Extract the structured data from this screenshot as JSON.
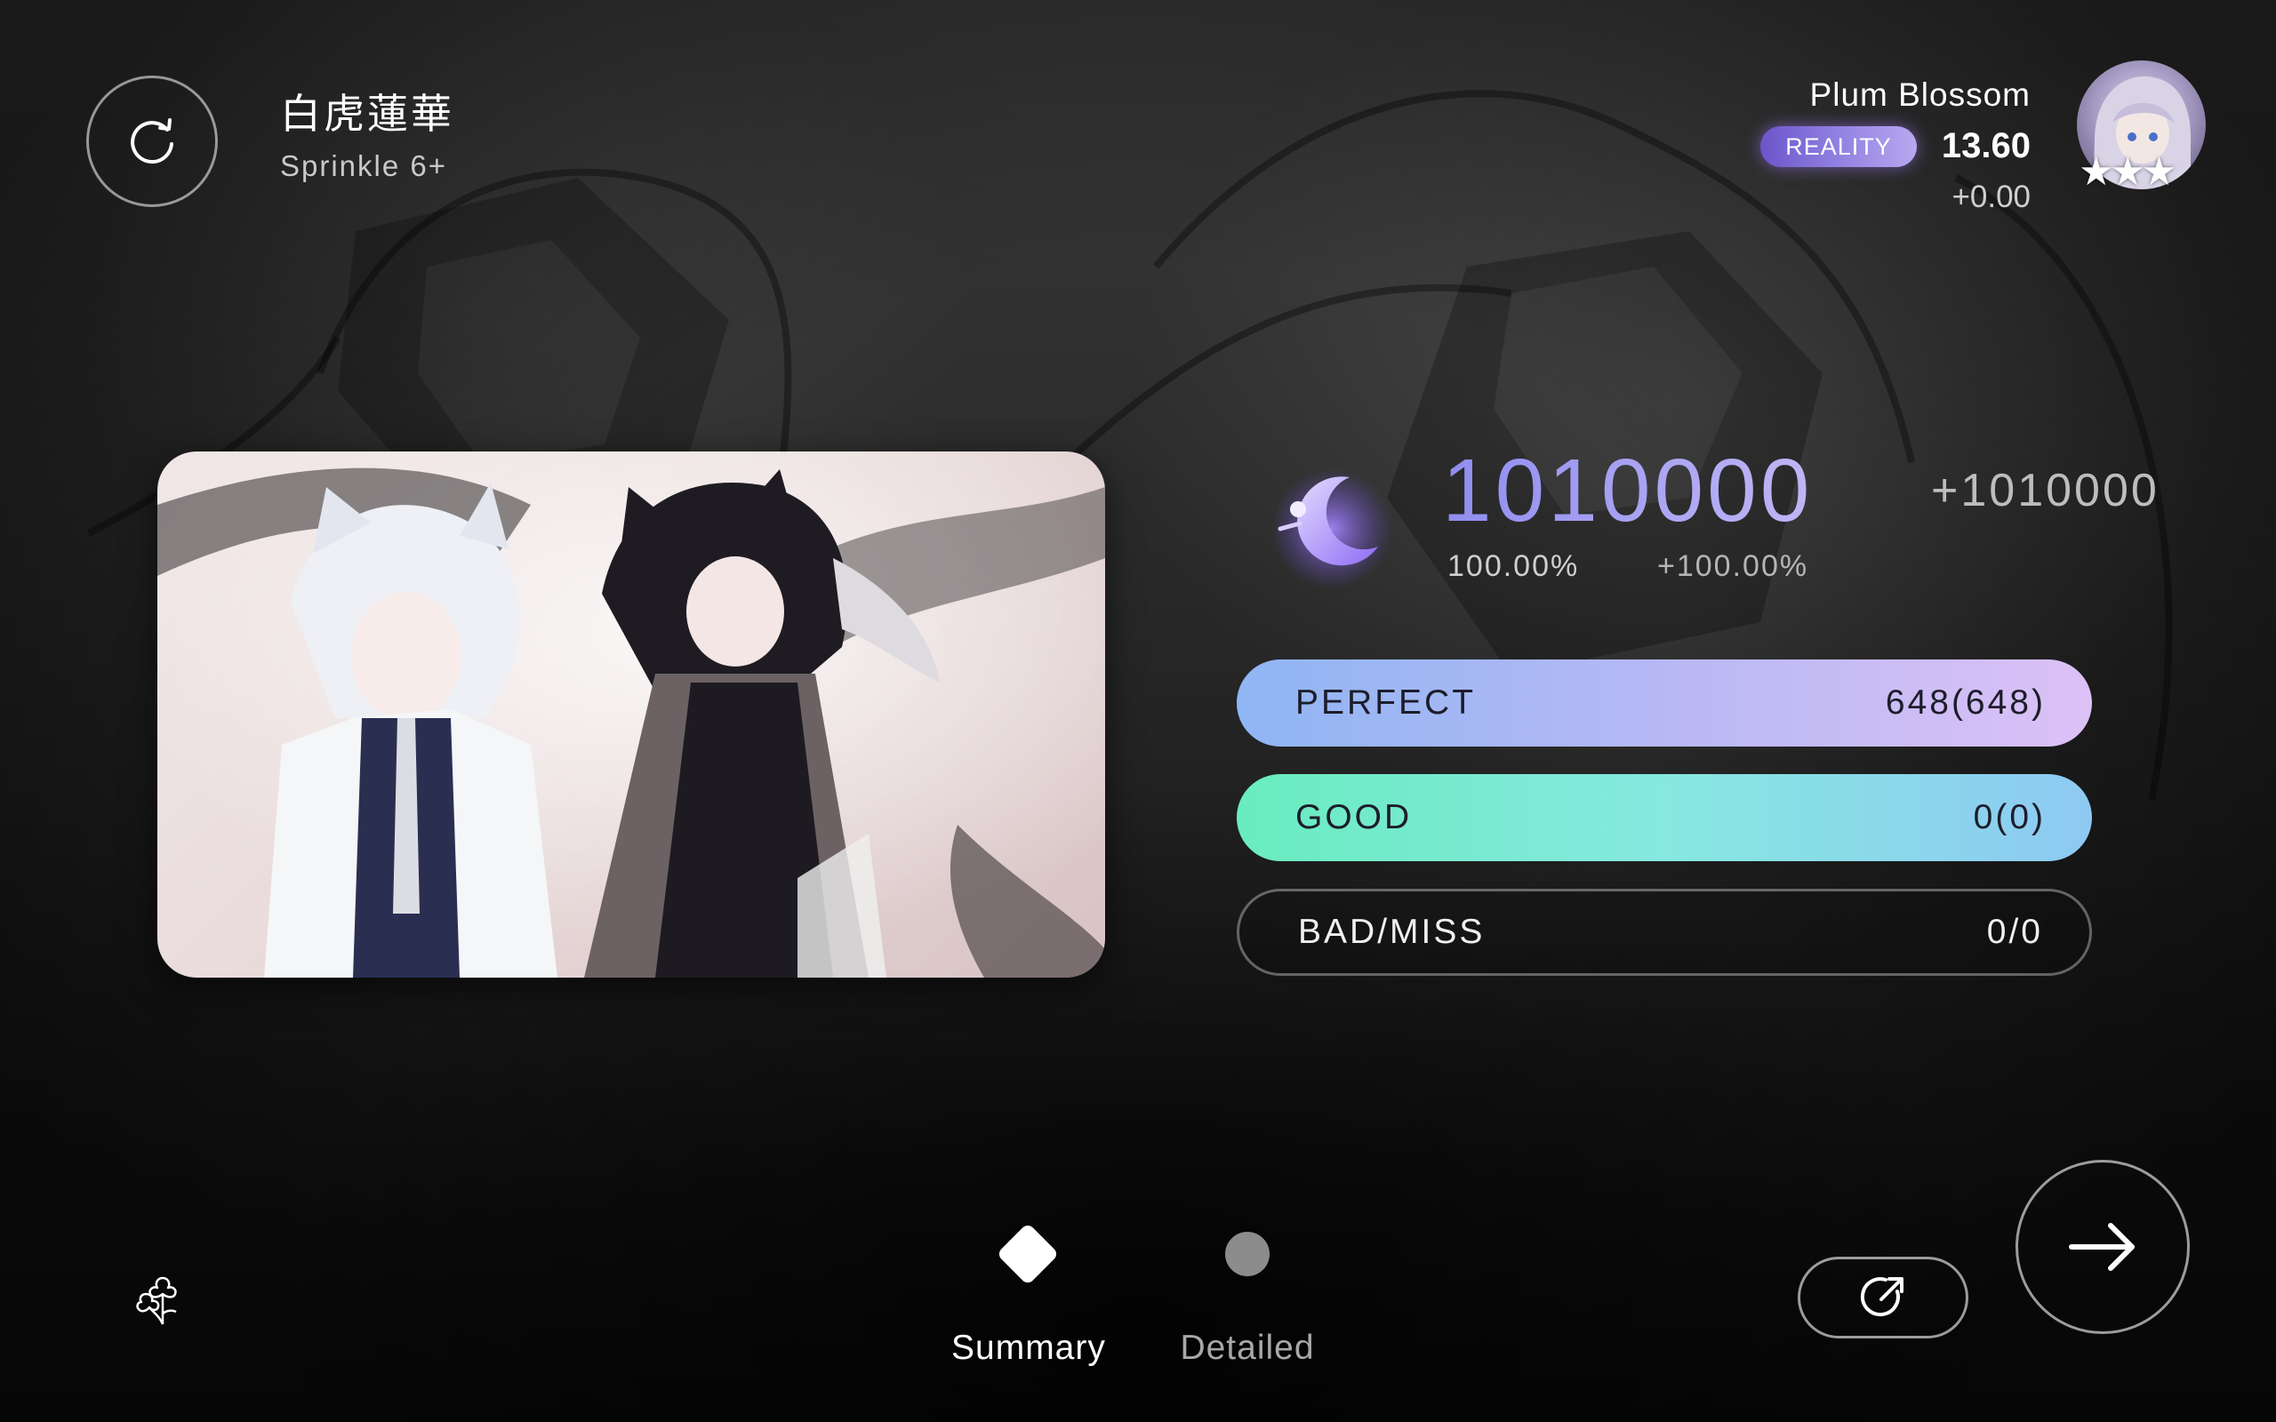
{
  "song": {
    "title": "白虎蓮華",
    "difficulty": "Sprinkle 6+"
  },
  "player": {
    "name": "Plum Blossom",
    "badge": "REALITY",
    "rating": "13.60",
    "rating_delta": "+0.00",
    "stars": "★★★"
  },
  "result": {
    "score": "1010000",
    "score_delta": "+1010000",
    "accuracy": "100.00%",
    "accuracy_delta": "+100.00%"
  },
  "judgements": [
    {
      "label": "PERFECT",
      "value": "648(648)"
    },
    {
      "label": "GOOD",
      "value": "0(0)"
    },
    {
      "label": "BAD/MISS",
      "value": "0/0"
    }
  ],
  "tabs": [
    {
      "label": "Summary",
      "icon": "diamond-icon",
      "selected": true
    },
    {
      "label": "Detailed",
      "icon": "dot-icon",
      "selected": false
    }
  ],
  "icons": {
    "retry": "retry-icon",
    "share": "share-icon",
    "next": "arrow-right-icon",
    "grade": "moon-icon",
    "flower": "flower-icon"
  },
  "colors": {
    "perfect_start": "#8fb6f3",
    "perfect_end": "#dcc1f6",
    "good_start": "#69ecbf",
    "good_end": "#8ec9f3",
    "score_accent": "#9d97f0",
    "badge": "#7d6ad6"
  }
}
